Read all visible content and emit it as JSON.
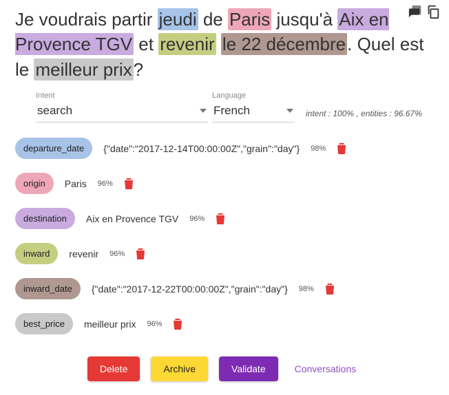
{
  "sentence": {
    "parts": [
      {
        "text": "Je voudrais partir "
      },
      {
        "text": "jeudi",
        "class": "hl-blue"
      },
      {
        "text": " de "
      },
      {
        "text": "Paris",
        "class": "hl-pink"
      },
      {
        "text": " jusqu'à "
      },
      {
        "text": "Aix en Provence TGV",
        "class": "hl-purple"
      },
      {
        "text": " et "
      },
      {
        "text": "revenir",
        "class": "hl-olive"
      },
      {
        "text": " "
      },
      {
        "text": "le 22 décembre",
        "class": "hl-brown"
      },
      {
        "text": ". Quel est le "
      },
      {
        "text": "meilleur prix",
        "class": "hl-gray"
      },
      {
        "text": "?"
      }
    ]
  },
  "controls": {
    "intent_label": "Intent",
    "intent_value": "search",
    "language_label": "Language",
    "language_value": "French",
    "stats": "intent : 100% , entities : 96.67%"
  },
  "entities": [
    {
      "name": "departure_date",
      "color": "blue",
      "value": "{\"date\":\"2017-12-14T00:00:00Z\",\"grain\":\"day\"}",
      "confidence": "98%"
    },
    {
      "name": "origin",
      "color": "pink",
      "value": "Paris",
      "confidence": "96%"
    },
    {
      "name": "destination",
      "color": "purple",
      "value": "Aix en Provence TGV",
      "confidence": "96%"
    },
    {
      "name": "inward",
      "color": "olive",
      "value": "revenir",
      "confidence": "96%"
    },
    {
      "name": "inward_date",
      "color": "brown",
      "value": "{\"date\":\"2017-12-22T00:00:00Z\",\"grain\":\"day\"}",
      "confidence": "98%"
    },
    {
      "name": "best_price",
      "color": "gray",
      "value": "meilleur prix",
      "confidence": "96%"
    }
  ],
  "actions": {
    "delete": "Delete",
    "archive": "Archive",
    "validate": "Validate",
    "conversations": "Conversations"
  }
}
